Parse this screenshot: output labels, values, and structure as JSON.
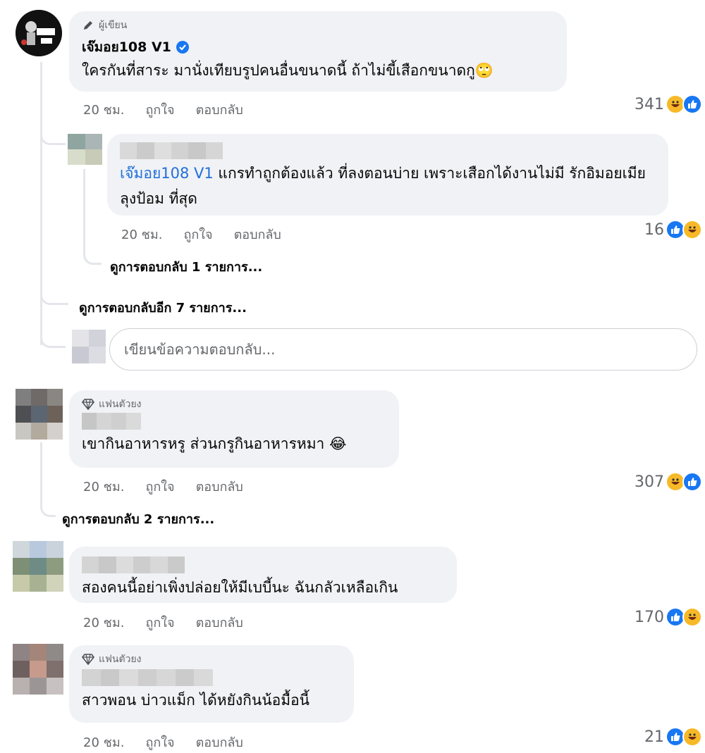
{
  "colors": {
    "like": "#1877f2",
    "haha": "#f7b928",
    "tag": "#216fdb",
    "muted": "#65676b",
    "bubble": "#f0f2f5"
  },
  "comments": [
    {
      "badge": "ผู้เขียน",
      "badge_icon": "pencil-icon",
      "author": "เจ๊มอย108 V1",
      "verified": true,
      "text": "ใครกันที่สาระ มานั่งเทียบรูปคนอื่นขนาดนี้  ถ้าไม่ขี้เสือกขนาดกู🙄",
      "time": "20 ชม.",
      "like_label": "ถูกใจ",
      "reply_label": "ตอบกลับ",
      "reactions": {
        "count": "341",
        "icons": [
          "haha",
          "like"
        ]
      },
      "replies": [
        {
          "tag": "เจ๊มอย108 V1",
          "text": " แกรทำถูกต้องแล้ว ที่ลงตอนบ่าย เพราะเสือกได้งานไม่มี รักอิมอยเมียลุงป้อม ที่สุด",
          "time": "20 ชม.",
          "like_label": "ถูกใจ",
          "reply_label": "ตอบกลับ",
          "reactions": {
            "count": "16",
            "icons": [
              "like",
              "haha"
            ]
          },
          "view_replies": "ดูการตอบกลับ 1 รายการ..."
        }
      ],
      "view_more_replies": "ดูการตอบกลับอีก 7 รายการ...",
      "reply_placeholder": "เขียนข้อความตอบกลับ..."
    },
    {
      "badge": "แฟนตัวยง",
      "badge_icon": "diamond-icon",
      "text": "เขากินอาหารหรู ส่วนกรูกินอาหารหมา 😂",
      "time": "20 ชม.",
      "like_label": "ถูกใจ",
      "reply_label": "ตอบกลับ",
      "reactions": {
        "count": "307",
        "icons": [
          "haha",
          "like"
        ]
      },
      "view_replies": "ดูการตอบกลับ 2 รายการ..."
    },
    {
      "text": "สองคนนี้อย่าเพิ่งปล่อยให้มีเบบี้นะ ฉันกลัวเหลือเกิน",
      "time": "20 ชม.",
      "like_label": "ถูกใจ",
      "reply_label": "ตอบกลับ",
      "reactions": {
        "count": "170",
        "icons": [
          "like",
          "haha"
        ]
      }
    },
    {
      "badge": "แฟนตัวยง",
      "badge_icon": "diamond-icon",
      "text": "สาวพอน บ่าวแม็ก ได้หยังกินน้อมื้อนี้",
      "time": "20 ชม.",
      "like_label": "ถูกใจ",
      "reply_label": "ตอบกลับ",
      "reactions": {
        "count": "21",
        "icons": [
          "like",
          "haha"
        ]
      }
    }
  ]
}
